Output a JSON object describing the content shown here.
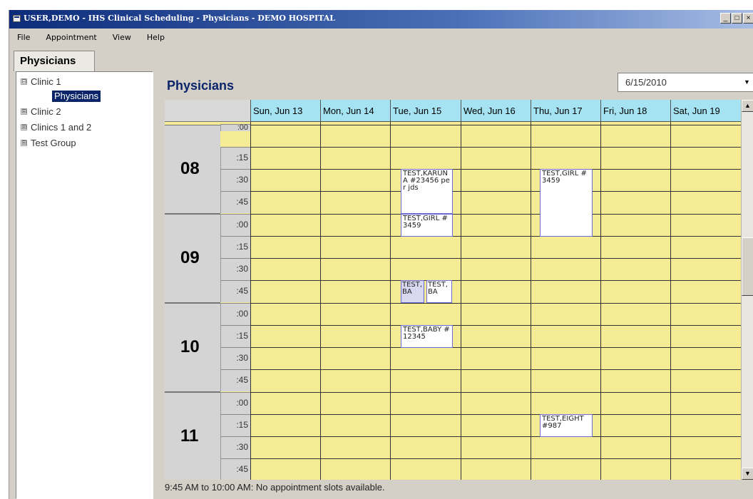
{
  "window": {
    "title": "USER,DEMO - IHS Clinical Scheduling - Physicians - DEMO HOSPITAL",
    "controls": [
      "_",
      "□",
      "×"
    ]
  },
  "menu": [
    "File",
    "Appointment",
    "View",
    "Help"
  ],
  "tab": "Physicians",
  "tree": {
    "nodes": [
      {
        "label": "Clinic 1",
        "expander": "⊟"
      },
      {
        "label": "Clinic 2",
        "expander": "⊞"
      },
      {
        "label": "Clinics 1 and 2",
        "expander": "⊞"
      },
      {
        "label": "Test Group",
        "expander": "⊞"
      }
    ],
    "selected": "Physicians"
  },
  "schedule": {
    "title": "Physicians",
    "date": "6/15/2010",
    "days": [
      "Sun, Jun 13",
      "Mon, Jun 14",
      "Tue, Jun 15",
      "Wed, Jun 16",
      "Thu, Jun 17",
      "Fri, Jun 18",
      "Sat, Jun 19"
    ],
    "hours": [
      "08",
      "09",
      "10",
      "11"
    ],
    "minutes": [
      ":00",
      ":15",
      ":30",
      ":45"
    ],
    "appointments": [
      {
        "text": "TEST,KARUNA #23456 per jds"
      },
      {
        "text": "TEST,GIRL #3459"
      },
      {
        "text": "TEST,BA"
      },
      {
        "text": "TEST,BA"
      },
      {
        "text": "TEST,BABY #12345"
      },
      {
        "text": "TEST,GIRL #3459"
      },
      {
        "text": "TEST,EIGHT #987"
      }
    ]
  },
  "status": "9:45 AM to 10:00 AM: No appointment slots available."
}
